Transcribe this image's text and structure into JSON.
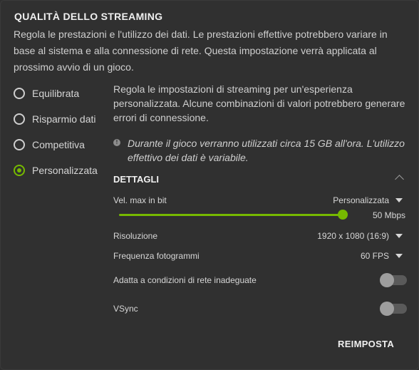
{
  "header": {
    "title": "QUALITÀ DELLO STREAMING",
    "description": "Regola le prestazioni e l'utilizzo dei dati. Le prestazioni effettive potrebbero variare in base al sistema e alla connessione di rete. Questa impostazione verrà applicata al prossimo avvio di un gioco."
  },
  "presets": [
    {
      "label": "Equilibrata",
      "checked": false
    },
    {
      "label": "Risparmio dati",
      "checked": false
    },
    {
      "label": "Competitiva",
      "checked": false
    },
    {
      "label": "Personalizzata",
      "checked": true
    }
  ],
  "custom": {
    "description": "Regola le impostazioni di streaming per un'esperienza personalizzata. Alcune combinazioni di valori potrebbero generare errori di connessione.",
    "info": "Durante il gioco verranno utilizzati circa 15 GB all'ora. L'utilizzo effettivo dei dati è variabile."
  },
  "details": {
    "title": "DETTAGLI",
    "bitrate": {
      "label": "Vel. max in bit",
      "mode": "Personalizzata",
      "value": "50 Mbps",
      "slider_fraction": 1.0
    },
    "resolution": {
      "label": "Risoluzione",
      "value": "1920 x 1080 (16:9)"
    },
    "framerate": {
      "label": "Frequenza fotogrammi",
      "value": "60 FPS"
    },
    "adapt": {
      "label": "Adatta a condizioni di rete inadeguate",
      "enabled": false
    },
    "vsync": {
      "label": "VSync",
      "enabled": false
    }
  },
  "actions": {
    "reset": "REIMPOSTA"
  },
  "colors": {
    "accent": "#76b900",
    "background": "#303030"
  }
}
